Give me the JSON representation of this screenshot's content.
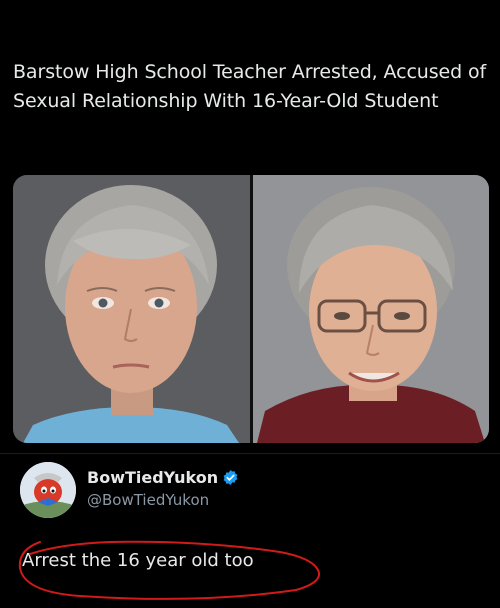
{
  "headline": "Barstow High School Teacher Arrested, Accused of Sexual Relationship With 16-Year-Old Student",
  "photos": [
    {
      "icon": "mugshot-photo",
      "background": "#5b5d60"
    },
    {
      "icon": "portrait-photo",
      "background": "#8b8d90"
    }
  ],
  "author": {
    "display_name": "BowTiedYukon",
    "handle": "@BowTiedYukon",
    "verified_icon": "verified-badge-icon",
    "badge_color": "#1d9bf0",
    "avatar_icon": "avatar-icon"
  },
  "tweet": {
    "text": "Arrest the 16 year old too"
  },
  "annotation": {
    "icon": "red-circle-scribble",
    "color": "#d11a1a"
  }
}
